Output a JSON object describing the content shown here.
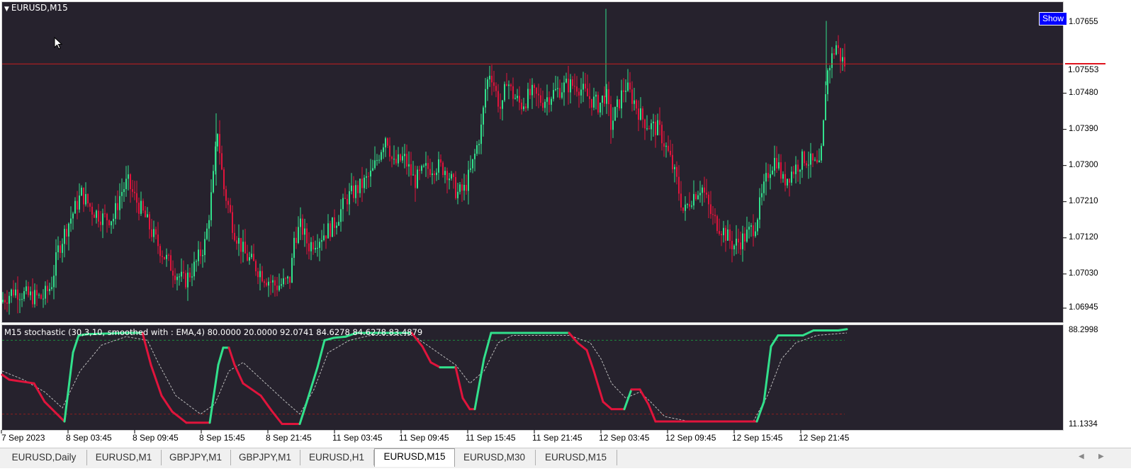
{
  "chart": {
    "symbol_label": "EURUSD,M15",
    "show_button": "Show",
    "current_price": "1.07553",
    "price_labels": [
      "1.07655",
      "1.07480",
      "1.07390",
      "1.07300",
      "1.07210",
      "1.07120",
      "1.07030",
      "1.06945"
    ],
    "time_labels": [
      "7 Sep 2023",
      "8 Sep 03:45",
      "8 Sep 09:45",
      "8 Sep 15:45",
      "8 Sep 21:45",
      "11 Sep 03:45",
      "11 Sep 09:45",
      "11 Sep 15:45",
      "11 Sep 21:45",
      "12 Sep 03:45",
      "12 Sep 09:45",
      "12 Sep 15:45",
      "12 Sep 21:45"
    ],
    "colors": {
      "background": "#26222d",
      "bull": "#32e08c",
      "bear": "#e0143c",
      "price_line": "#c81e1e",
      "signal": "#bbbbbb"
    }
  },
  "indicator": {
    "label": "M15 stochastic (30,3,10, smoothed with : EMA,4) 80.0000 20.0000 92.0741 84.6278 84.6278 83.4879",
    "scale_max": "88.2998",
    "scale_min": "11.1334"
  },
  "chart_data": {
    "type": "candlestick",
    "symbol": "EURUSD",
    "timeframe": "M15",
    "y_range": [
      1.06915,
      1.07705
    ],
    "current_price": 1.07553,
    "x_labels": [
      "7 Sep 2023",
      "8 Sep 03:45",
      "8 Sep 09:45",
      "8 Sep 15:45",
      "8 Sep 21:45",
      "11 Sep 03:45",
      "11 Sep 09:45",
      "11 Sep 15:45",
      "11 Sep 21:45",
      "12 Sep 03:45",
      "12 Sep 09:45",
      "12 Sep 15:45",
      "12 Sep 21:45"
    ],
    "close_path": [
      [
        0,
        1.0696
      ],
      [
        20,
        1.0699
      ],
      [
        40,
        1.06975
      ],
      [
        60,
        1.0697
      ],
      [
        72,
        1.07
      ],
      [
        82,
        1.0709
      ],
      [
        95,
        1.0715
      ],
      [
        105,
        1.0719
      ],
      [
        115,
        1.0723
      ],
      [
        130,
        1.0719
      ],
      [
        145,
        1.0717
      ],
      [
        160,
        1.0717
      ],
      [
        170,
        1.0723
      ],
      [
        180,
        1.0726
      ],
      [
        190,
        1.0722
      ],
      [
        205,
        1.0717
      ],
      [
        215,
        1.0713
      ],
      [
        230,
        1.0708
      ],
      [
        245,
        1.0704
      ],
      [
        260,
        1.0701
      ],
      [
        275,
        1.0705
      ],
      [
        290,
        1.0711
      ],
      [
        300,
        1.0725
      ],
      [
        307,
        1.0739
      ],
      [
        315,
        1.0725
      ],
      [
        330,
        1.0714
      ],
      [
        345,
        1.0708
      ],
      [
        360,
        1.0705
      ],
      [
        375,
        1.0702
      ],
      [
        390,
        1.07
      ],
      [
        405,
        1.0701
      ],
      [
        410,
        1.0702
      ],
      [
        415,
        1.0712
      ],
      [
        425,
        1.0715
      ],
      [
        435,
        1.071
      ],
      [
        450,
        1.0712
      ],
      [
        470,
        1.0715
      ],
      [
        490,
        1.0722
      ],
      [
        510,
        1.0725
      ],
      [
        525,
        1.0728
      ],
      [
        535,
        1.0733
      ],
      [
        545,
        1.0738
      ],
      [
        555,
        1.073
      ],
      [
        570,
        1.0732
      ],
      [
        585,
        1.0726
      ],
      [
        600,
        1.0729
      ],
      [
        615,
        1.073
      ],
      [
        630,
        1.0729
      ],
      [
        645,
        1.0723
      ],
      [
        655,
        1.0724
      ],
      [
        665,
        1.0729
      ],
      [
        672,
        1.0734
      ],
      [
        680,
        1.074
      ],
      [
        685,
        1.0749
      ],
      [
        692,
        1.0754
      ],
      [
        700,
        1.0748
      ],
      [
        708,
        1.0743
      ],
      [
        715,
        1.0752
      ],
      [
        722,
        1.0748
      ],
      [
        735,
        1.0745
      ],
      [
        750,
        1.0748
      ],
      [
        765,
        1.0746
      ],
      [
        780,
        1.0748
      ],
      [
        800,
        1.075
      ],
      [
        815,
        1.075
      ],
      [
        830,
        1.0747
      ],
      [
        845,
        1.0745
      ],
      [
        855,
        1.0748
      ],
      [
        862,
        1.074
      ],
      [
        872,
        1.0745
      ],
      [
        882,
        1.075
      ],
      [
        895,
        1.0746
      ],
      [
        905,
        1.0742
      ],
      [
        915,
        1.074
      ],
      [
        930,
        1.0739
      ],
      [
        945,
        1.0732
      ],
      [
        955,
        1.0726
      ],
      [
        965,
        1.0718
      ],
      [
        975,
        1.0722
      ],
      [
        990,
        1.0725
      ],
      [
        1005,
        1.0717
      ],
      [
        1020,
        1.0714
      ],
      [
        1035,
        1.071
      ],
      [
        1050,
        1.0712
      ],
      [
        1065,
        1.0715
      ],
      [
        1075,
        1.0722
      ],
      [
        1085,
        1.0729
      ],
      [
        1095,
        1.0732
      ],
      [
        1105,
        1.0726
      ],
      [
        1120,
        1.0729
      ],
      [
        1135,
        1.0732
      ],
      [
        1150,
        1.073
      ],
      [
        1157,
        1.0729
      ],
      [
        1162,
        1.074
      ],
      [
        1166,
        1.0752
      ],
      [
        1172,
        1.0756
      ],
      [
        1180,
        1.076
      ],
      [
        1186,
        1.0757
      ],
      [
        1192,
        1.07553
      ]
    ],
    "stochastic": {
      "levels": [
        80,
        20
      ],
      "scale": [
        11.1334,
        88.2998
      ],
      "main": [
        [
          0,
          52
        ],
        [
          10,
          48
        ],
        [
          45,
          45
        ],
        [
          60,
          30
        ],
        [
          88,
          14
        ],
        [
          100,
          70
        ],
        [
          108,
          84
        ],
        [
          120,
          85
        ],
        [
          175,
          86
        ],
        [
          198,
          86
        ],
        [
          210,
          60
        ],
        [
          225,
          35
        ],
        [
          240,
          22
        ],
        [
          260,
          13
        ],
        [
          293,
          13
        ],
        [
          305,
          60
        ],
        [
          312,
          74
        ],
        [
          320,
          74
        ],
        [
          328,
          60
        ],
        [
          340,
          45
        ],
        [
          365,
          35
        ],
        [
          380,
          23
        ],
        [
          395,
          12
        ],
        [
          420,
          12
        ],
        [
          430,
          30
        ],
        [
          445,
          58
        ],
        [
          455,
          80
        ],
        [
          468,
          82
        ],
        [
          485,
          83
        ],
        [
          500,
          86
        ],
        [
          578,
          86
        ],
        [
          593,
          75
        ],
        [
          605,
          62
        ],
        [
          618,
          58
        ],
        [
          640,
          58
        ],
        [
          650,
          33
        ],
        [
          660,
          24
        ],
        [
          667,
          24
        ],
        [
          680,
          65
        ],
        [
          690,
          86
        ],
        [
          800,
          86
        ],
        [
          812,
          78
        ],
        [
          825,
          72
        ],
        [
          835,
          55
        ],
        [
          848,
          30
        ],
        [
          860,
          24
        ],
        [
          878,
          24
        ],
        [
          888,
          40
        ],
        [
          900,
          40
        ],
        [
          912,
          28
        ],
        [
          922,
          14
        ],
        [
          1065,
          14
        ],
        [
          1075,
          30
        ],
        [
          1085,
          75
        ],
        [
          1095,
          84
        ],
        [
          1130,
          84
        ],
        [
          1145,
          88
        ],
        [
          1180,
          88
        ],
        [
          1192,
          89
        ]
      ],
      "signal": [
        [
          0,
          55
        ],
        [
          30,
          48
        ],
        [
          60,
          38
        ],
        [
          85,
          25
        ],
        [
          110,
          55
        ],
        [
          140,
          76
        ],
        [
          175,
          83
        ],
        [
          205,
          80
        ],
        [
          220,
          62
        ],
        [
          245,
          35
        ],
        [
          280,
          20
        ],
        [
          300,
          28
        ],
        [
          320,
          55
        ],
        [
          340,
          62
        ],
        [
          370,
          46
        ],
        [
          400,
          30
        ],
        [
          420,
          20
        ],
        [
          440,
          40
        ],
        [
          460,
          70
        ],
        [
          490,
          80
        ],
        [
          520,
          84
        ],
        [
          580,
          84
        ],
        [
          610,
          72
        ],
        [
          640,
          60
        ],
        [
          660,
          45
        ],
        [
          680,
          55
        ],
        [
          700,
          78
        ],
        [
          720,
          84
        ],
        [
          800,
          84
        ],
        [
          830,
          78
        ],
        [
          845,
          65
        ],
        [
          860,
          45
        ],
        [
          880,
          33
        ],
        [
          900,
          38
        ],
        [
          915,
          30
        ],
        [
          935,
          18
        ],
        [
          970,
          14
        ],
        [
          1060,
          14
        ],
        [
          1080,
          35
        ],
        [
          1100,
          65
        ],
        [
          1120,
          78
        ],
        [
          1150,
          84
        ],
        [
          1192,
          86
        ]
      ]
    }
  }
}
